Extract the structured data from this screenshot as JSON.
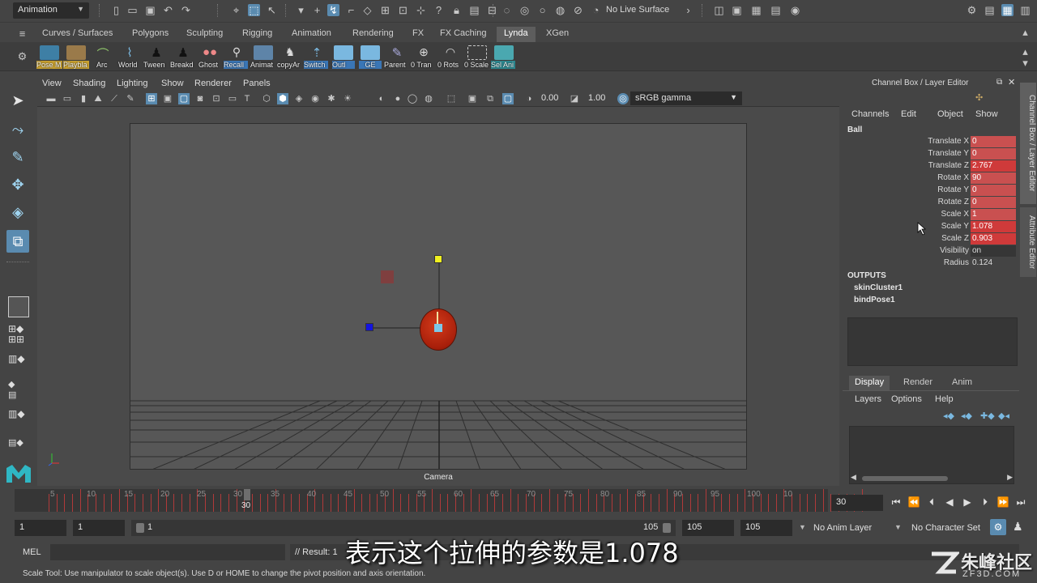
{
  "status_line": {
    "menu_set": "Animation",
    "live_surface": "No Live Surface"
  },
  "shelf": {
    "tabs": [
      "Curves / Surfaces",
      "Polygons",
      "Sculpting",
      "Rigging",
      "Animation",
      "Rendering",
      "FX",
      "FX Caching",
      "Lynda",
      "XGen"
    ],
    "active_tab": "Lynda",
    "buttons": [
      "Pose M",
      "Playbla",
      "Arc",
      "World",
      "Tween",
      "Breakd",
      "Ghost",
      "Recall",
      "Animat",
      "copyAr",
      "Switch",
      "Outl",
      "GE",
      "Parent",
      "0 Tran",
      "0 Rots",
      "0 Scale",
      "Sel Ani"
    ]
  },
  "panel": {
    "menus": [
      "View",
      "Shading",
      "Lighting",
      "Show",
      "Renderer",
      "Panels"
    ],
    "exposure": "0.00",
    "gamma": "1.00",
    "color_space": "sRGB gamma",
    "camera_label": "Camera"
  },
  "channel_box": {
    "title": "Channel Box / Layer Editor",
    "menus": [
      "Channels",
      "Edit",
      "Object",
      "Show"
    ],
    "object": "Ball",
    "attributes": [
      {
        "label": "Translate X",
        "value": "0"
      },
      {
        "label": "Translate Y",
        "value": "0"
      },
      {
        "label": "Translate Z",
        "value": "2.767"
      },
      {
        "label": "Rotate X",
        "value": "90"
      },
      {
        "label": "Rotate Y",
        "value": "0"
      },
      {
        "label": "Rotate Z",
        "value": "0"
      },
      {
        "label": "Scale X",
        "value": "1"
      },
      {
        "label": "Scale Y",
        "value": "1.078"
      },
      {
        "label": "Scale Z",
        "value": "0.903"
      },
      {
        "label": "Visibility",
        "value": "on"
      },
      {
        "label": "Radius",
        "value": "0.124"
      }
    ],
    "outputs_label": "OUTPUTS",
    "outputs": [
      "skinCluster1",
      "bindPose1"
    ]
  },
  "layer_editor": {
    "tabs": [
      "Display",
      "Render",
      "Anim"
    ],
    "menus": [
      "Layers",
      "Options",
      "Help"
    ]
  },
  "side_tabs": [
    "Channel Box / Layer Editor",
    "Attribute Editor"
  ],
  "time_slider": {
    "ticks": [
      "5",
      "10",
      "15",
      "20",
      "25",
      "30",
      "35",
      "40",
      "45",
      "50",
      "55",
      "60",
      "65",
      "70",
      "75",
      "80",
      "85",
      "90",
      "95",
      "100",
      "10"
    ],
    "current_frame": "30",
    "current_frame_field": "30"
  },
  "range_slider": {
    "start": "1",
    "playback_start": "1",
    "range_start_label": "1",
    "range_end_label": "105",
    "playback_end": "105",
    "end": "105",
    "anim_layer": "No Anim Layer",
    "character_set": "No Character Set"
  },
  "command_line": {
    "mel_label": "MEL",
    "result": "// Result: 1"
  },
  "help_line": "Scale Tool: Use manipulator to scale object(s). Use D or HOME to change the pivot position and axis orientation.",
  "subtitle": "表示这个拉伸的参数是1.078",
  "watermark": {
    "title": "朱峰社区",
    "url": "ZF3D.COM"
  }
}
